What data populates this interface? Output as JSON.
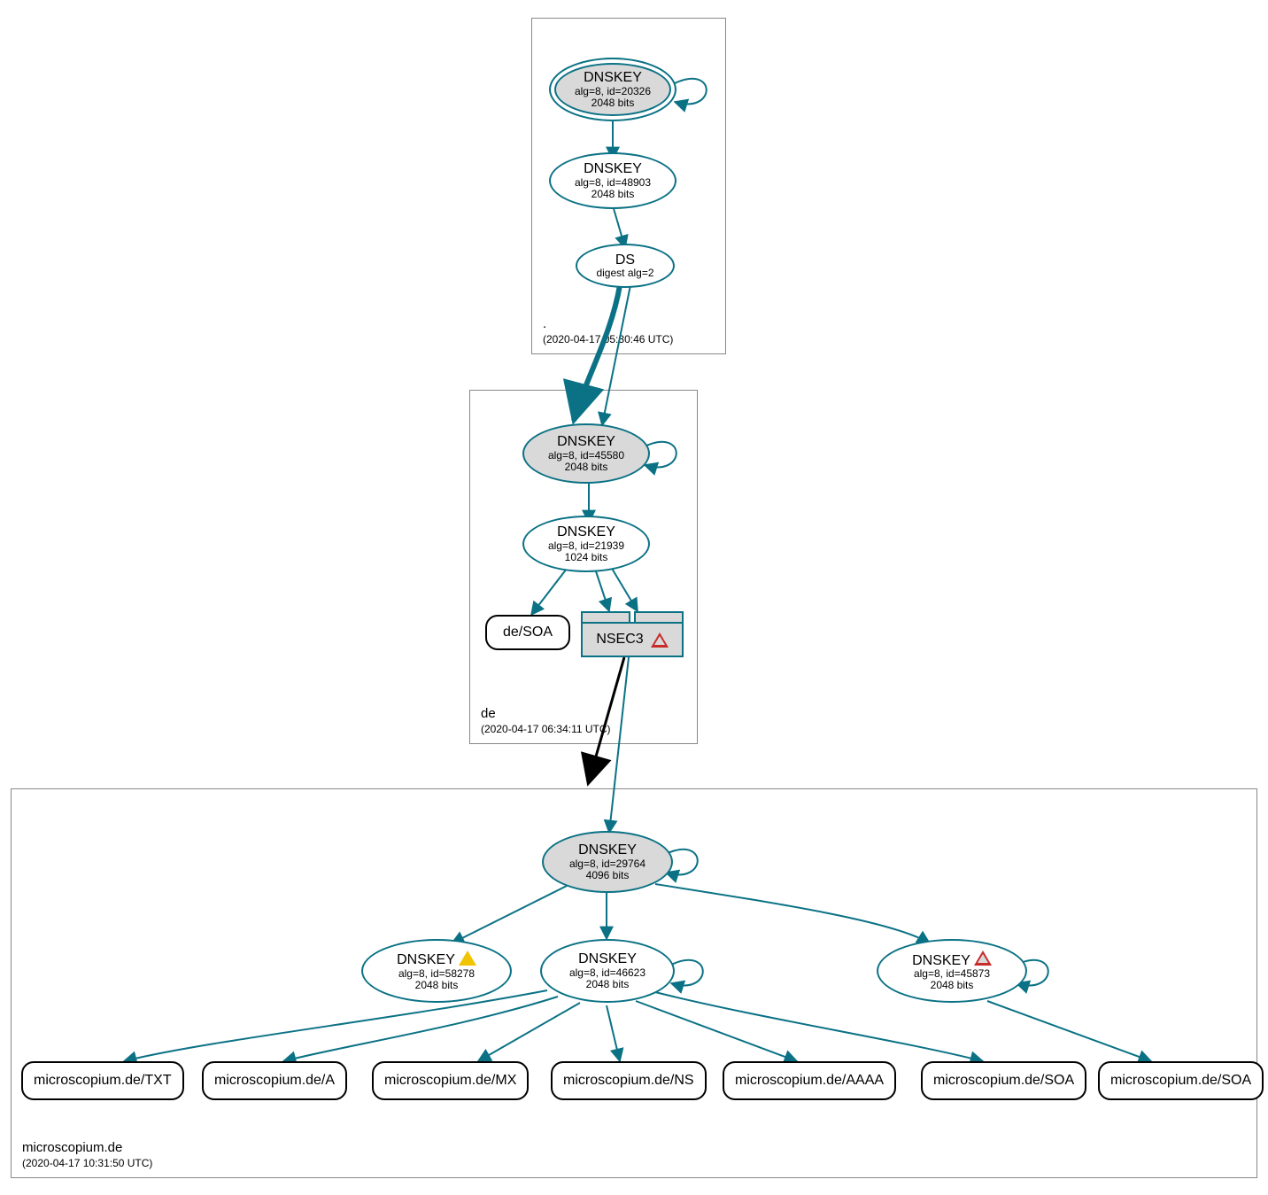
{
  "colors": {
    "stroke": "#0b7285",
    "zoneBorder": "#888888",
    "nodeGray": "#d9d9d9"
  },
  "zones": {
    "root": {
      "name": ".",
      "timestamp": "(2020-04-17 05:30:46 UTC)"
    },
    "de": {
      "name": "de",
      "timestamp": "(2020-04-17 06:34:11 UTC)"
    },
    "dom": {
      "name": "microscopium.de",
      "timestamp": "(2020-04-17 10:31:50 UTC)"
    }
  },
  "nodes": {
    "root_ksk": {
      "title": "DNSKEY",
      "line2": "alg=8, id=20326",
      "line3": "2048 bits"
    },
    "root_zsk": {
      "title": "DNSKEY",
      "line2": "alg=8, id=48903",
      "line3": "2048 bits"
    },
    "root_ds": {
      "title": "DS",
      "line2": "digest alg=2",
      "line3": ""
    },
    "de_ksk": {
      "title": "DNSKEY",
      "line2": "alg=8, id=45580",
      "line3": "2048 bits"
    },
    "de_zsk": {
      "title": "DNSKEY",
      "line2": "alg=8, id=21939",
      "line3": "1024 bits"
    },
    "de_soa": {
      "label": "de/SOA"
    },
    "de_nsec3": {
      "label": "NSEC3"
    },
    "dom_ksk": {
      "title": "DNSKEY",
      "line2": "alg=8, id=29764",
      "line3": "4096 bits"
    },
    "dom_k1": {
      "title": "DNSKEY",
      "line2": "alg=8, id=58278",
      "line3": "2048 bits",
      "warn": "yellow"
    },
    "dom_k2": {
      "title": "DNSKEY",
      "line2": "alg=8, id=46623",
      "line3": "2048 bits"
    },
    "dom_k3": {
      "title": "DNSKEY",
      "line2": "alg=8, id=45873",
      "line3": "2048 bits",
      "warn": "red"
    },
    "rr_txt": {
      "label": "microscopium.de/TXT"
    },
    "rr_a": {
      "label": "microscopium.de/A"
    },
    "rr_mx": {
      "label": "microscopium.de/MX"
    },
    "rr_ns": {
      "label": "microscopium.de/NS"
    },
    "rr_aaaa": {
      "label": "microscopium.de/AAAA"
    },
    "rr_soa1": {
      "label": "microscopium.de/SOA"
    },
    "rr_soa2": {
      "label": "microscopium.de/SOA"
    }
  }
}
